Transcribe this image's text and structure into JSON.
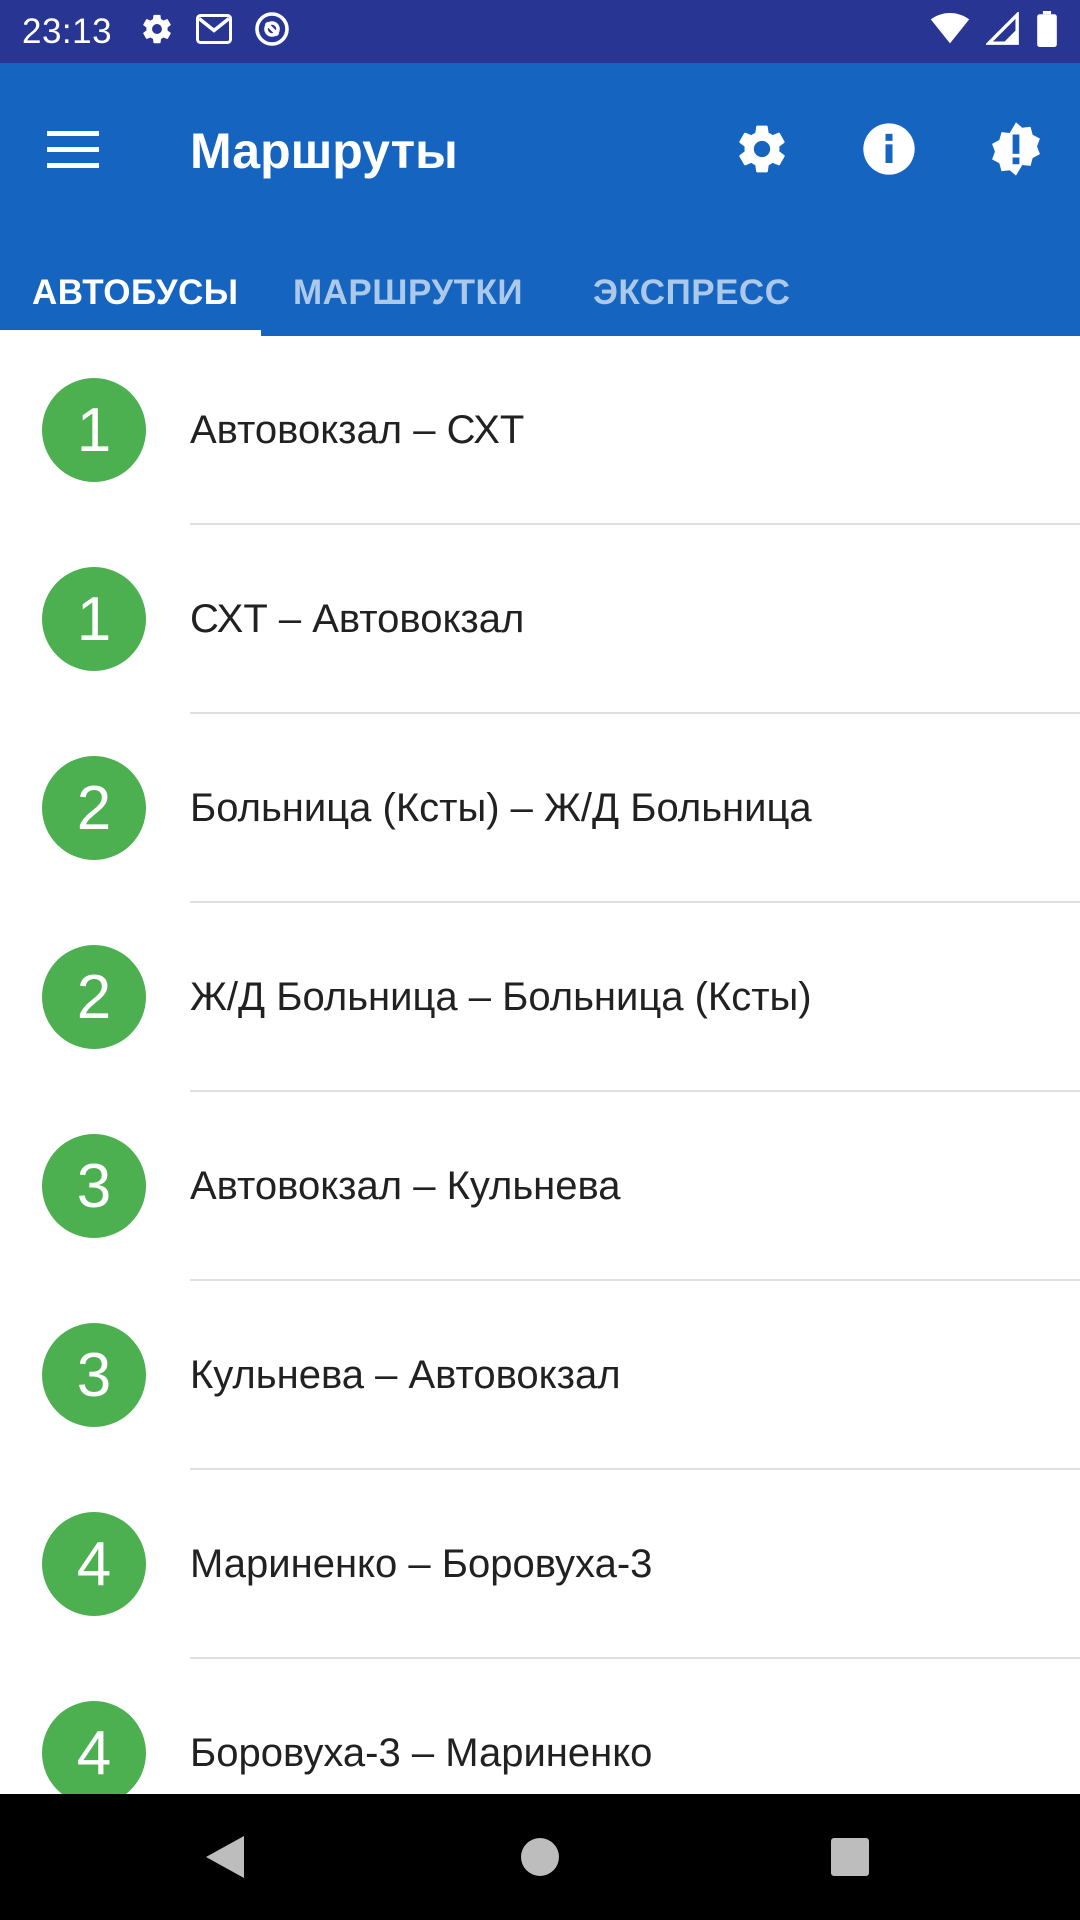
{
  "status_bar": {
    "time": "23:13",
    "left_icons": [
      "settings-icon",
      "gmail-icon",
      "at-sign-icon"
    ],
    "right_icons": [
      "wifi-icon",
      "signal-icon",
      "battery-icon"
    ]
  },
  "app_bar": {
    "title": "Маршруты",
    "actions": [
      "settings-icon",
      "info-icon",
      "alert-badge-icon"
    ]
  },
  "tabs": [
    {
      "label": "АВТОБУСЫ",
      "active": true
    },
    {
      "label": "МАРШРУТКИ",
      "active": false
    },
    {
      "label": "ЭКСПРЕСС",
      "active": false
    }
  ],
  "routes": [
    {
      "number": "1",
      "name": "Автовокзал – СХТ"
    },
    {
      "number": "1",
      "name": "СХТ – Автовокзал"
    },
    {
      "number": "2",
      "name": "Больница (Ксты) – Ж/Д Больница"
    },
    {
      "number": "2",
      "name": "Ж/Д Больница – Больница (Ксты)"
    },
    {
      "number": "3",
      "name": "Автовокзал – Кульнева"
    },
    {
      "number": "3",
      "name": "Кульнева – Автовокзал"
    },
    {
      "number": "4",
      "name": "Мариненко – Боровуха-3"
    },
    {
      "number": "4",
      "name": "Боровуха-3 – Мариненко"
    }
  ],
  "colors": {
    "status_bar": "#283593",
    "app_bar": "#1565c0",
    "badge": "#4caf50"
  },
  "nav_bar": [
    "back-icon",
    "home-icon",
    "recents-icon"
  ]
}
